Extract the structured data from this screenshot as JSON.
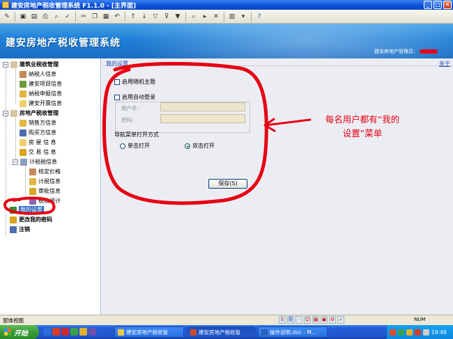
{
  "window": {
    "title": "建安房地产税收管理系统 F1.1.0 - [主界面]"
  },
  "banner": {
    "title": "建安房地产税收管理系统",
    "user_label": "建安房地产管理员："
  },
  "nav": {
    "groups": [
      {
        "label": "建筑业税收管理",
        "items": [
          "纳税人信息",
          "建安项目信息",
          "纳税申报信息",
          "建安开票信息"
        ]
      },
      {
        "label": "房地产税收管理",
        "items": [
          "销售方信息",
          "购买方信息",
          "房 屋 信 息",
          "交 易 信 息"
        ]
      }
    ],
    "subgroup": {
      "label": "计税税信息",
      "items": [
        "核定价格",
        "计税信息",
        "审批信息",
        "税收统计"
      ]
    },
    "my_settings": "我的设置",
    "change_password": "更改我的密码",
    "logout": "注销"
  },
  "main": {
    "title": "我的设置",
    "about": "关于",
    "random_theme": "启用随机主题",
    "auto_login": "启用自动登录",
    "username_label": "用户名：",
    "password_label": "密码：",
    "nav_open_label": "导航菜单打开方式",
    "single_click": "单击打开",
    "double_click": "双击打开",
    "selected_open_mode": "双击打开",
    "save_button": "保存(S)"
  },
  "annotation": {
    "line1": "每名用户都有“我的",
    "line2": "设置”菜单",
    "color": "#e60012"
  },
  "statusbar": {
    "left": "窗体视图",
    "ime_label": "英",
    "num": "NUM"
  },
  "taskbar": {
    "start": "开始",
    "tasks": [
      "建安房地产税收管",
      "建安房地产税收管",
      "操作说明.doc - M..."
    ],
    "clock": "19:49"
  }
}
